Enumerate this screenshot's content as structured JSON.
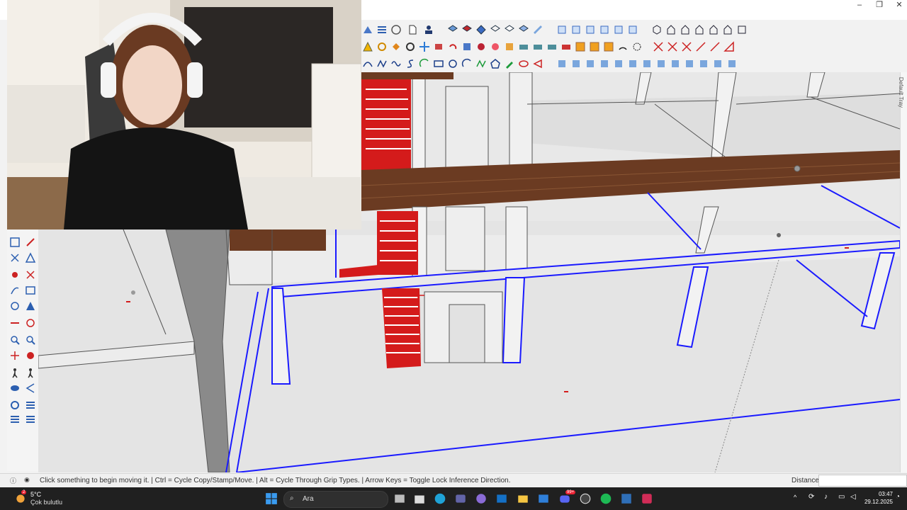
{
  "app": {
    "right_tray_label": "Default Tray"
  },
  "status": {
    "hint": "Click something to begin moving it. | Ctrl = Cycle Copy/Stamp/Move. | Alt = Cycle Through Grip Types. | Arrow Keys = Toggle Lock Inference Direction.",
    "measurements_label": "Distance",
    "measurements_value": ""
  },
  "taskbar": {
    "weather_temp": "5°C",
    "weather_desc": "Çok bulutlu",
    "weather_badge": "2",
    "search_placeholder": "Ara",
    "discord_badge": "99+",
    "time": "03:47",
    "date": "29.12.2025"
  },
  "colors": {
    "selection_blue": "#1a1aff",
    "stair_red": "#e01b1b",
    "beam_wood": "#6b3b22",
    "taskbar_bg": "#202020"
  },
  "icons": {
    "toolbar_rows": [
      "style-icons",
      "tools-icons",
      "sandbox-icons"
    ],
    "left_tools": [
      "select-icon",
      "paint-icon",
      "eraser-icon",
      "tape-icon",
      "move-icon",
      "rotate-icon",
      "orbit-icon",
      "pan-icon",
      "zoom-icon",
      "zoom-extents-icon",
      "walk-icon",
      "position-camera-icon",
      "look-around-icon",
      "section-plane-icon",
      "display-section-icon"
    ]
  }
}
